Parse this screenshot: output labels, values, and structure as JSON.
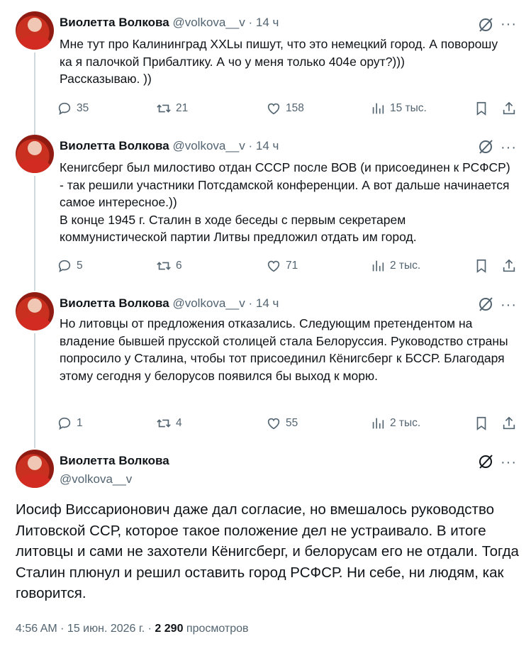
{
  "tweets": [
    {
      "name": "Виолетта Волкова",
      "handle": "@volkova__v",
      "sep": " · ",
      "time": "14 ч",
      "text": "Мне тут про Калининград XXLы пишут, что это немецкий город.  А поворошу ка я палочкой Прибалтику. А чо у меня только 404е орут?)))\nРассказываю. ))",
      "replies": "35",
      "reposts": "21",
      "likes": "158",
      "views": "15 тыс."
    },
    {
      "name": "Виолетта Волкова",
      "handle": "@volkova__v",
      "sep": " · ",
      "time": "14 ч",
      "text": "Кенигсберг был милостиво отдан СССР после ВОВ (и присоединен к РСФСР) - так решили участники Потсдамской конференции. А вот дальше начинается самое интересное.))\nВ конце 1945 г. Сталин в ходе беседы с первым секретарем коммунистической партии Литвы предложил отдать им город.",
      "replies": "5",
      "reposts": "6",
      "likes": "71",
      "views": "2 тыс."
    },
    {
      "name": "Виолетта Волкова",
      "handle": "@volkova__v",
      "sep": " · ",
      "time": "14 ч",
      "text": "Но литовцы от предложения отказались. Следующим претендентом на владение бывшей прусской столицей стала Белоруссия. Руководство страны попросило у Сталина, чтобы тот присоединил Кёнигсберг к БССР. Благодаря этому сегодня у белорусов появился бы выход к морю.",
      "replies": "1",
      "reposts": "4",
      "likes": "55",
      "views": "2 тыс."
    }
  ],
  "main": {
    "name": "Виолетта Волкова",
    "handle": "@volkova__v",
    "text": "Иосиф Виссарионович даже дал согласие, но вмешалось руководство Литовской ССР, которое такое положение дел не устраивало. В итоге литовцы и сами не захотели Кёнигсберг, и белорусам его не отдали. Тогда Сталин плюнул и решил оставить город РСФСР.  Ни себе, ни людям, как говорится.",
    "time": "4:56 AM",
    "sep": " · ",
    "date": "15 июн. 2026 г.",
    "views_count": "2 290",
    "views_label": "просмотров"
  },
  "more_label": "···",
  "icons": {
    "reply": "reply-icon",
    "repost": "repost-icon",
    "like": "heart-icon",
    "views": "views-icon",
    "bookmark": "bookmark-icon",
    "share": "share-icon",
    "grok": "grok-icon"
  },
  "colors": {
    "text": "#0f1419",
    "muted": "#536471",
    "thread_line": "#cfd9de",
    "background": "#ffffff"
  }
}
